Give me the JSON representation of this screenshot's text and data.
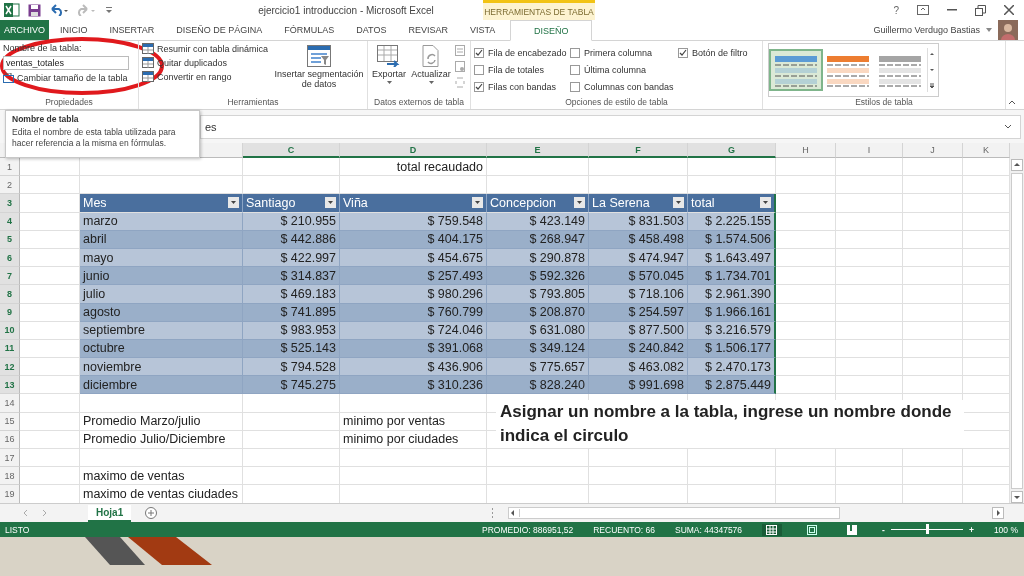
{
  "window": {
    "title": "ejercicio1 introduccion - Microsoft Excel",
    "tool_group": "HERRAMIENTAS DE TABLA",
    "user": "Guillermo Verdugo Bastias",
    "help": "?"
  },
  "tabs": [
    {
      "label": "ARCHIVO",
      "kind": "file",
      "selected": false
    },
    {
      "label": "INICIO",
      "kind": "tab",
      "selected": false
    },
    {
      "label": "INSERTAR",
      "kind": "tab",
      "selected": false
    },
    {
      "label": "DISEÑO DE PÁGINA",
      "kind": "tab",
      "selected": false
    },
    {
      "label": "FÓRMULAS",
      "kind": "tab",
      "selected": false
    },
    {
      "label": "DATOS",
      "kind": "tab",
      "selected": false
    },
    {
      "label": "REVISAR",
      "kind": "tab",
      "selected": false
    },
    {
      "label": "VISTA",
      "kind": "tab",
      "selected": false
    },
    {
      "label": "DISEÑO",
      "kind": "tool",
      "selected": true
    }
  ],
  "ribbon": {
    "properties": {
      "label": "Propiedades",
      "name_label": "Nombre de la tabla:",
      "name_value": "ventas_totales",
      "resize": "Cambiar tamaño de la tabla"
    },
    "tools": {
      "label": "Herramientas",
      "items": [
        "Resumir con tabla dinámica",
        "Quitar duplicados",
        "Convertir en rango"
      ],
      "slicer": "Insertar segmentación de datos"
    },
    "external": {
      "label": "Datos externos de tabla",
      "buttons": [
        "Exportar",
        "Actualizar"
      ]
    },
    "options": {
      "label": "Opciones de estilo de tabla",
      "checkboxes": [
        {
          "label": "Fila de encabezado",
          "checked": true
        },
        {
          "label": "Fila de totales",
          "checked": false
        },
        {
          "label": "Filas con bandas",
          "checked": true
        },
        {
          "label": "Primera columna",
          "checked": false
        },
        {
          "label": "Última columna",
          "checked": false
        },
        {
          "label": "Columnas con bandas",
          "checked": false
        },
        {
          "label": "Botón de filtro",
          "checked": true
        }
      ]
    },
    "styles": {
      "label": "Estilos de tabla",
      "items": [
        {
          "color": "#5b9bd5",
          "selected": true
        },
        {
          "color": "#ed7d31",
          "selected": false
        },
        {
          "color": "#a5a5a5",
          "selected": false
        }
      ]
    }
  },
  "tooltip": {
    "title": "Nombre de tabla",
    "body": "Edita el nombre de esta tabla utilizada para hacer referencia a la misma en fórmulas."
  },
  "formula_bar": {
    "value": "es"
  },
  "sheet": {
    "columns": [
      "C",
      "D",
      "E",
      "F",
      "G",
      "H",
      "I",
      "J",
      "K"
    ],
    "rows": [
      {
        "number": "1",
        "kind": "plain",
        "d": "total recaudado"
      },
      {
        "number": "2",
        "kind": "plain"
      },
      {
        "number": "3",
        "kind": "table-header",
        "cells": [
          "Mes",
          "Santiago",
          "Viña",
          "Concepcion",
          "La Serena",
          "total"
        ]
      },
      {
        "number": "4",
        "kind": "table-row",
        "cells": [
          "marzo",
          "$ 210.955",
          "$ 759.548",
          "$ 423.149",
          "$ 831.503",
          "$ 2.225.155"
        ]
      },
      {
        "number": "5",
        "kind": "table-row",
        "cells": [
          "abril",
          "$ 442.886",
          "$ 404.175",
          "$ 268.947",
          "$ 458.498",
          "$ 1.574.506"
        ]
      },
      {
        "number": "6",
        "kind": "table-row",
        "cells": [
          "mayo",
          "$ 422.997",
          "$ 454.675",
          "$ 290.878",
          "$ 474.947",
          "$ 1.643.497"
        ]
      },
      {
        "number": "7",
        "kind": "table-row",
        "cells": [
          "junio",
          "$ 314.837",
          "$ 257.493",
          "$ 592.326",
          "$ 570.045",
          "$ 1.734.701"
        ]
      },
      {
        "number": "8",
        "kind": "table-row",
        "cells": [
          "julio",
          "$ 469.183",
          "$ 980.296",
          "$ 793.805",
          "$ 718.106",
          "$ 2.961.390"
        ]
      },
      {
        "number": "9",
        "kind": "table-row",
        "cells": [
          "agosto",
          "$ 741.895",
          "$ 760.799",
          "$ 208.870",
          "$ 254.597",
          "$ 1.966.161"
        ]
      },
      {
        "number": "10",
        "kind": "table-row",
        "cells": [
          "septiembre",
          "$ 983.953",
          "$ 724.046",
          "$ 631.080",
          "$ 877.500",
          "$ 3.216.579"
        ]
      },
      {
        "number": "11",
        "kind": "table-row",
        "cells": [
          "octubre",
          "$ 525.143",
          "$ 391.068",
          "$ 349.124",
          "$ 240.842",
          "$ 1.506.177"
        ]
      },
      {
        "number": "12",
        "kind": "table-row",
        "cells": [
          "noviembre",
          "$ 794.528",
          "$ 436.906",
          "$ 775.657",
          "$ 463.082",
          "$ 2.470.173"
        ]
      },
      {
        "number": "13",
        "kind": "table-row",
        "cells": [
          "diciembre",
          "$ 745.275",
          "$ 310.236",
          "$ 828.240",
          "$ 991.698",
          "$ 2.875.449"
        ]
      },
      {
        "number": "14",
        "kind": "plain"
      },
      {
        "number": "15",
        "kind": "plain",
        "b": "Promedio Marzo/julio",
        "d": "minimo por ventas"
      },
      {
        "number": "16",
        "kind": "plain",
        "b": "Promedio Julio/Diciembre",
        "d": "minimo por ciudades"
      },
      {
        "number": "17",
        "kind": "plain"
      },
      {
        "number": "18",
        "kind": "plain",
        "b": "maximo de ventas"
      },
      {
        "number": "19",
        "kind": "plain",
        "b": "maximo de ventas ciudades"
      }
    ]
  },
  "note": "Asignar un nombre a la tabla, ingrese un nombre donde indica el circulo",
  "sheet_tabs": [
    {
      "label": "Hoja1",
      "selected": true
    }
  ],
  "status_bar": {
    "status": "LISTO",
    "average": "PROMEDIO: 886951,52",
    "count": "RECUENTO: 66",
    "sum": "SUMA: 44347576",
    "zoom": "100 %",
    "zoom_out": "-",
    "zoom_in": "+",
    "zoom_level": {
      "level": 0.5
    }
  }
}
